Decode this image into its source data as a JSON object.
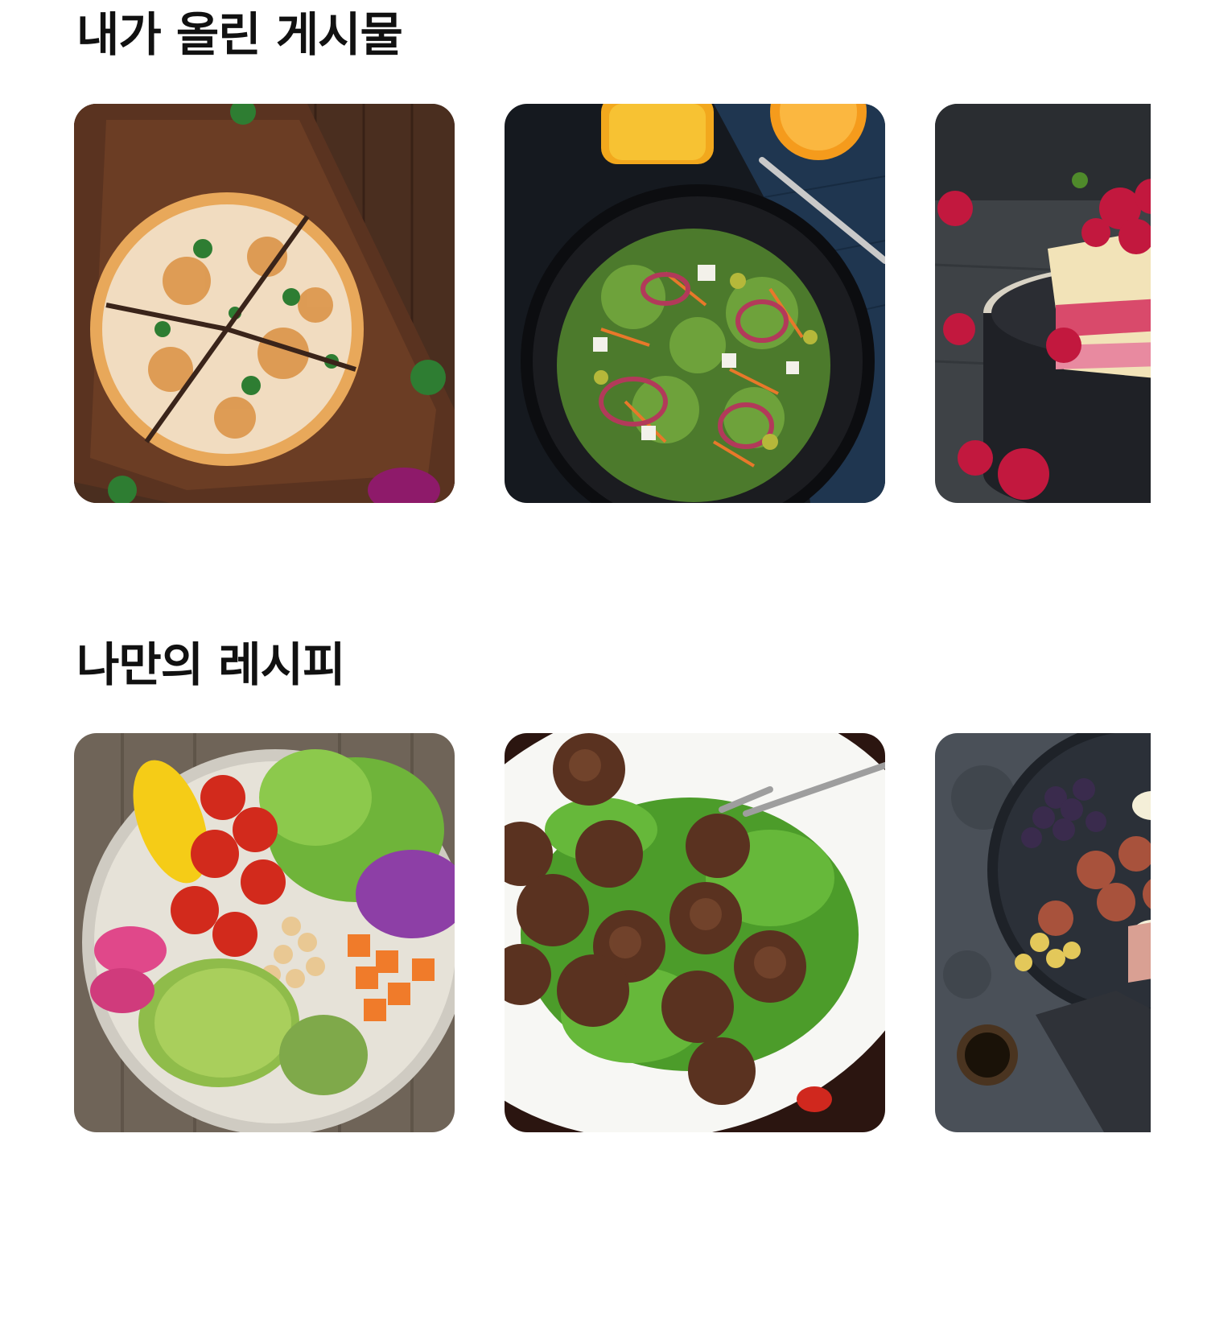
{
  "sections": {
    "my_posts": {
      "title": "내가 올린 게시물",
      "items": [
        {
          "icon": "pizza-photo"
        },
        {
          "icon": "salad-photo"
        },
        {
          "icon": "raspberry-cake-photo"
        }
      ]
    },
    "my_recipes": {
      "title": "나만의 레시피",
      "items": [
        {
          "icon": "vegetable-bowl-photo"
        },
        {
          "icon": "meatballs-photo"
        },
        {
          "icon": "fig-platter-photo"
        }
      ]
    }
  }
}
